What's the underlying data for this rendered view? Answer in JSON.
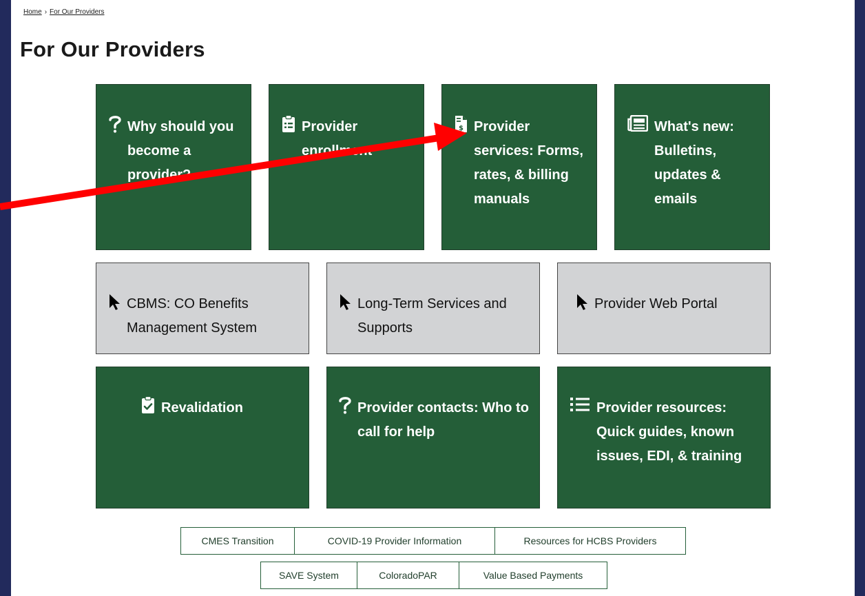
{
  "breadcrumb": {
    "home": "Home",
    "separator": "›",
    "current": "For Our Providers"
  },
  "page_title": "For Our Providers",
  "tiles_row1": [
    {
      "icon": "question-icon",
      "label": "Why should you become a provider?"
    },
    {
      "icon": "clipboard-list-icon",
      "label": "Provider enrollment"
    },
    {
      "icon": "file-invoice-dollar-icon",
      "label": "Provider services: Forms, rates, & billing manuals"
    },
    {
      "icon": "newspaper-icon",
      "label": "What's new: Bulletins, updates & emails"
    }
  ],
  "tiles_row2": [
    {
      "icon": "cursor-pointer-icon",
      "label": "CBMS: CO Benefits Management System"
    },
    {
      "icon": "cursor-pointer-icon",
      "label": "Long-Term Services and Supports"
    },
    {
      "icon": "cursor-pointer-icon",
      "label": "Provider Web Portal"
    }
  ],
  "tiles_row3": [
    {
      "icon": "clipboard-check-icon",
      "label": "Revalidation"
    },
    {
      "icon": "question-icon",
      "label": "Provider contacts: Who to call for help"
    },
    {
      "icon": "list-icon",
      "label": "Provider resources: Quick guides, known issues, EDI, & training"
    }
  ],
  "buttons_row1": [
    "CMES Transition",
    "COVID-19 Provider Information",
    "Resources for HCBS Providers"
  ],
  "buttons_row2": [
    "SAVE System",
    "ColoradoPAR",
    "Value Based Payments"
  ],
  "colors": {
    "frame": "#222a5c",
    "tile_green": "#245e38",
    "tile_grey": "#d2d3d5",
    "annotation_arrow": "#ff0000"
  }
}
